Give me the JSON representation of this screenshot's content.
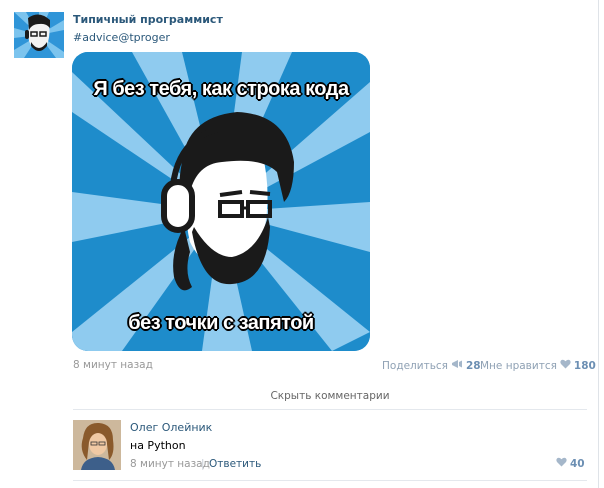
{
  "post": {
    "author": "Типичный программист",
    "text": "#advice@tproger",
    "image": {
      "top_caption": "Я без тебя, как строка кода",
      "bottom_caption": "без точки с запятой"
    },
    "time": "8 минут назад",
    "share_label": "Поделиться",
    "share_count": "28",
    "like_label": "Мне нравится",
    "like_count": "180",
    "hide_comments_label": "Скрыть комментарии"
  },
  "comment": {
    "author": "Олег Олейник",
    "text": "на Python",
    "time": "8 минут назад",
    "separator": "|",
    "reply_label": "Ответить",
    "like_count": "40"
  },
  "colors": {
    "link": "#2b587a",
    "muted": "#999999",
    "meme_blue": "#1e8ccb",
    "meme_light": "#8fcbef"
  },
  "icons": {
    "share": "megaphone-icon",
    "like": "heart-icon"
  }
}
